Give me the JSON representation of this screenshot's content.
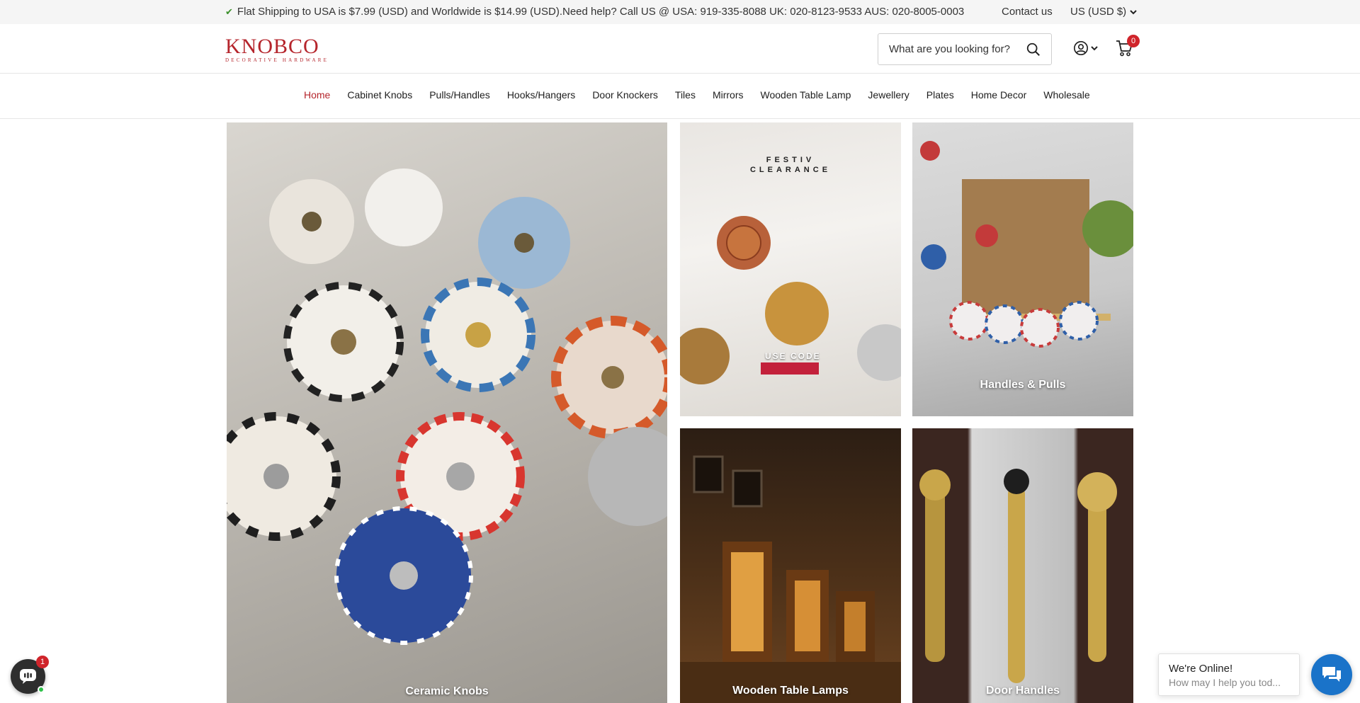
{
  "topbar": {
    "announcement": "Flat Shipping to USA is $7.99 (USD) and Worldwide is $14.99 (USD).Need help? Call US @ USA: 919-335-8088 UK: 020-8123-9533 AUS: 020-8005-0003",
    "contact_label": "Contact us",
    "currency_label": "US (USD $)"
  },
  "header": {
    "logo_wordmark": "KNOBCO",
    "logo_tagline": "DECORATIVE HARDWARE",
    "search_placeholder": "What are you looking for?",
    "cart_count": "0"
  },
  "nav": {
    "items": [
      {
        "label": "Home",
        "active": true
      },
      {
        "label": "Cabinet Knobs"
      },
      {
        "label": "Pulls/Handles"
      },
      {
        "label": "Hooks/Hangers"
      },
      {
        "label": "Door Knockers"
      },
      {
        "label": "Tiles"
      },
      {
        "label": "Mirrors"
      },
      {
        "label": "Wooden Table Lamp"
      },
      {
        "label": "Jewellery"
      },
      {
        "label": "Plates"
      },
      {
        "label": "Home Decor"
      },
      {
        "label": "Wholesale"
      }
    ]
  },
  "tiles": {
    "ceramic_knobs": "Ceramic Knobs",
    "promo_line1": "FESTIV",
    "promo_line2": "CLEARANCE",
    "promo_use_code": "USE CODE",
    "handles_pulls": "Handles & Pulls",
    "wooden_lamps": "Wooden Table Lamps",
    "door_handles": "Door Handles"
  },
  "chat": {
    "left_badge": "1",
    "status": "We're Online!",
    "prompt": "How may I help you tod..."
  },
  "colors": {
    "brand_red": "#b5252c",
    "badge_red": "#d0242b",
    "chat_blue": "#1a73c9"
  },
  "icons": [
    "check-icon",
    "chevron-down-icon",
    "search-icon",
    "user-icon",
    "cart-icon",
    "chat-icon"
  ]
}
